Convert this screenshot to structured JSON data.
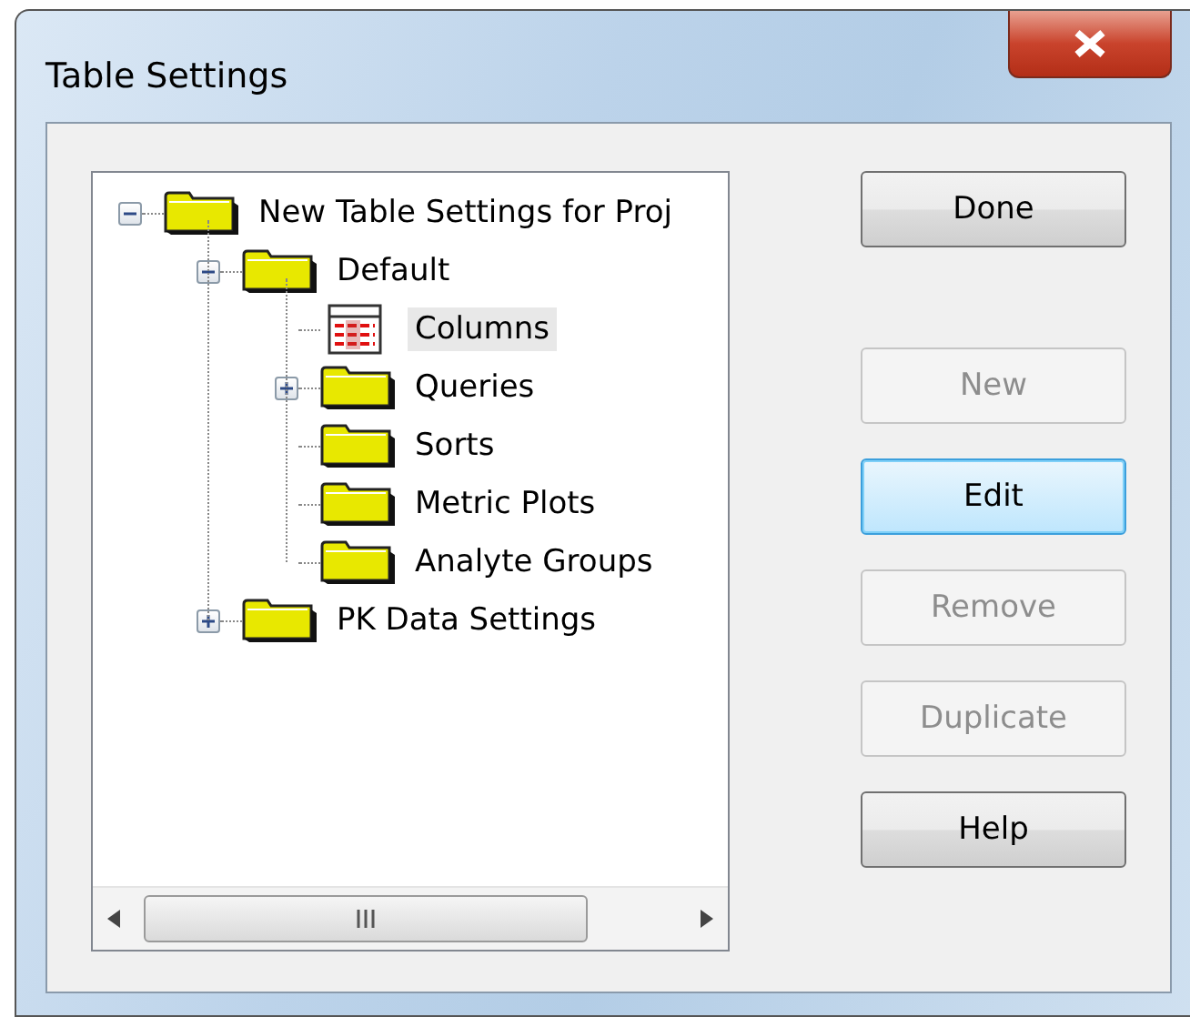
{
  "window": {
    "title": "Table Settings"
  },
  "tree": [
    {
      "label": "New Table Settings for Proj",
      "kind": "folder",
      "expanded": true,
      "selected": false,
      "children": [
        {
          "label": "Default",
          "kind": "folder",
          "expanded": true,
          "selected": false,
          "children": [
            {
              "label": "Columns",
              "kind": "table",
              "selected": true
            },
            {
              "label": "Queries",
              "kind": "folder",
              "expanded": false,
              "selected": false
            },
            {
              "label": "Sorts",
              "kind": "folder",
              "selected": false
            },
            {
              "label": "Metric Plots",
              "kind": "folder",
              "selected": false
            },
            {
              "label": "Analyte Groups",
              "kind": "folder",
              "selected": false
            }
          ]
        },
        {
          "label": "PK Data Settings",
          "kind": "folder",
          "expanded": false,
          "selected": false
        }
      ]
    }
  ],
  "buttons": [
    {
      "label": "Done",
      "disabled": false,
      "focused": false
    },
    {
      "label": "New",
      "disabled": true,
      "focused": false
    },
    {
      "label": "Edit",
      "disabled": false,
      "focused": true
    },
    {
      "label": "Remove",
      "disabled": true,
      "focused": false
    },
    {
      "label": "Duplicate",
      "disabled": true,
      "focused": false
    },
    {
      "label": "Help",
      "disabled": false,
      "focused": false
    }
  ]
}
